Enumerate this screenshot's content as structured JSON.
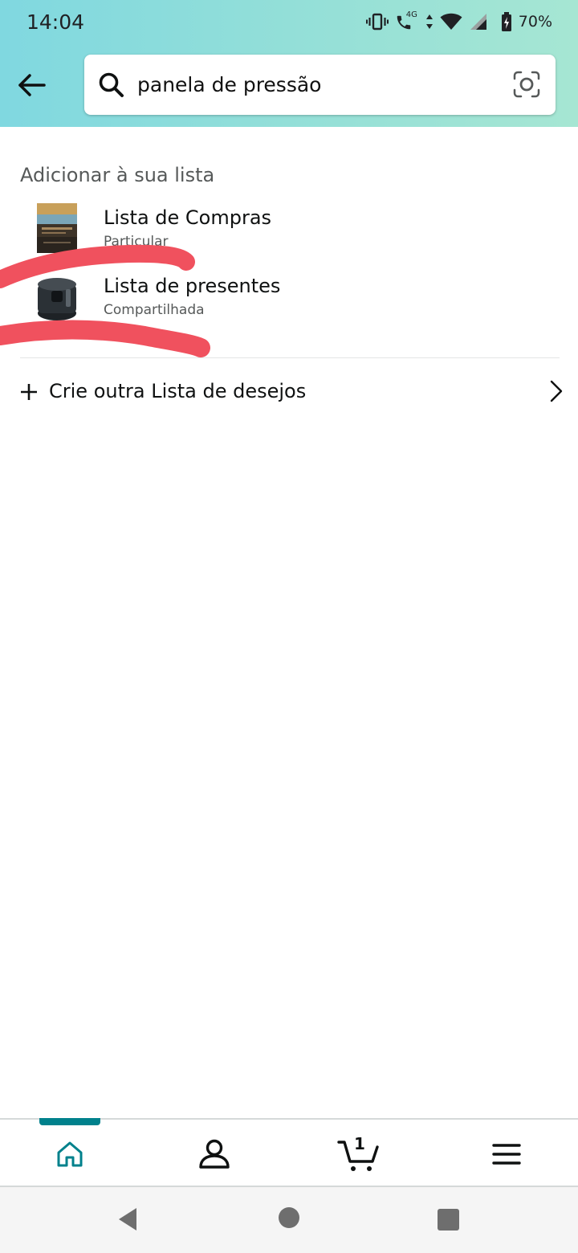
{
  "status_bar": {
    "time": "14:04",
    "network": "4G",
    "battery": "70%"
  },
  "search": {
    "query": "panela de pressão"
  },
  "section_title": "Adicionar à sua lista",
  "lists": [
    {
      "name": "Lista de Compras",
      "privacy": "Particular"
    },
    {
      "name": "Lista de presentes",
      "privacy": "Compartilhada"
    }
  ],
  "create_list_label": "Crie outra Lista de desejos",
  "bottom_nav": {
    "cart_count": "1",
    "active": "home"
  },
  "colors": {
    "accent": "#00818c",
    "scribble": "#f0515e",
    "header_gradient_start": "#80d8e0",
    "header_gradient_end": "#a6e6d3"
  },
  "icons": [
    "vibrate-icon",
    "call-4g-icon",
    "wifi-icon",
    "signal-icon",
    "battery-icon",
    "back-arrow-icon",
    "search-icon",
    "camera-icon",
    "plus-icon",
    "chevron-right-icon",
    "home-icon",
    "account-icon",
    "cart-icon",
    "menu-icon",
    "android-back-icon",
    "android-home-icon",
    "android-recents-icon"
  ]
}
